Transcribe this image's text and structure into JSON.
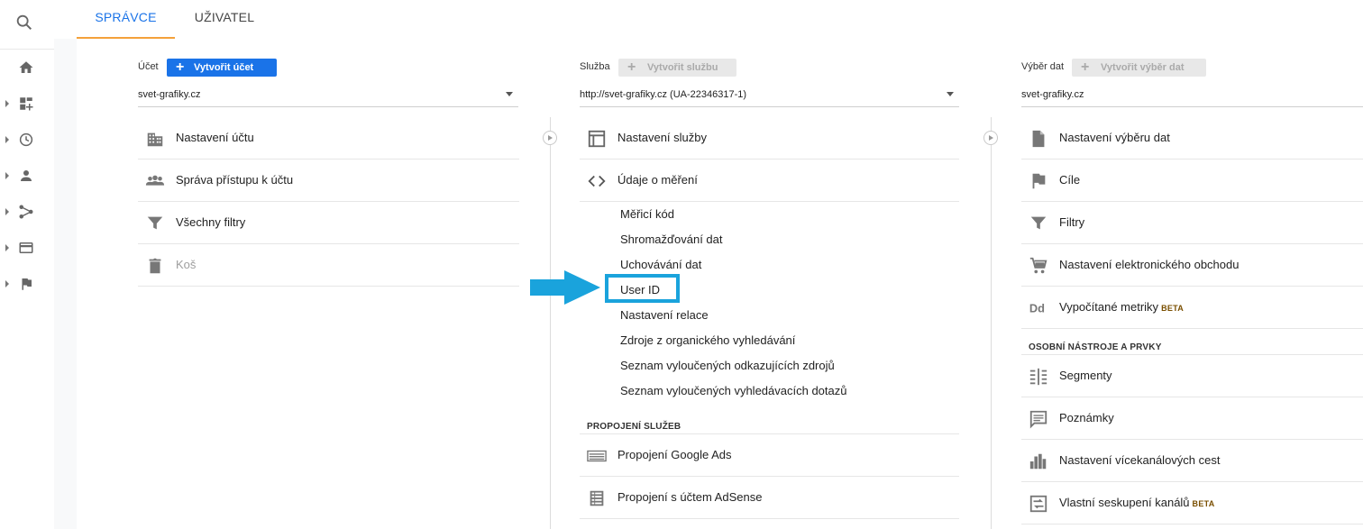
{
  "tabs": [
    {
      "label": "SPRÁVCE",
      "active": true
    },
    {
      "label": "UŽIVATEL",
      "active": false
    }
  ],
  "rail": {
    "items": [
      "search-icon",
      "home-icon",
      "dashboard-add-icon",
      "clock-icon",
      "person-icon",
      "flow-icon",
      "card-icon",
      "flag-icon"
    ]
  },
  "account": {
    "label": "Účet",
    "create_button": "Vytvořit účet",
    "selected": "svet-grafiky.cz",
    "items": [
      {
        "label": "Nastavení účtu",
        "icon": "building-icon"
      },
      {
        "label": "Správa přístupu k účtu",
        "icon": "people-icon"
      },
      {
        "label": "Všechny filtry",
        "icon": "filter-icon"
      },
      {
        "label": "Koš",
        "icon": "trash-icon",
        "disabled": true
      }
    ]
  },
  "property": {
    "label": "Služba",
    "create_button": "Vytvořit službu",
    "selected": "http://svet-grafiky.cz (UA-22346317-1)",
    "items": [
      {
        "label": "Nastavení služby",
        "icon": "layout-icon"
      },
      {
        "label": "Údaje o měření",
        "icon": "code-icon"
      }
    ],
    "subitems": [
      "Měřicí kód",
      "Shromažďování dat",
      "Uchovávání dat",
      "User ID",
      "Nastavení relace",
      "Zdroje z organického vyhledávání",
      "Seznam vyloučených odkazujících zdrojů",
      "Seznam vyloučených vyhledávacích dotazů"
    ],
    "section_heading": "PROPOJENÍ SLUŽEB",
    "links": [
      {
        "label": "Propojení Google Ads",
        "icon": "ads-icon"
      },
      {
        "label": "Propojení s účtem AdSense",
        "icon": "adsense-icon"
      }
    ]
  },
  "view": {
    "label": "Výběr dat",
    "create_button": "Vytvořit výběr dat",
    "selected": "svet-grafiky.cz",
    "items": [
      {
        "label": "Nastavení výběru dat",
        "icon": "document-icon"
      },
      {
        "label": "Cíle",
        "icon": "flag-icon"
      },
      {
        "label": "Filtry",
        "icon": "filter-icon"
      },
      {
        "label": "Nastavení elektronického obchodu",
        "icon": "cart-icon"
      },
      {
        "label": "Vypočítané metriky",
        "icon": "dd-icon",
        "badge": "BETA"
      }
    ],
    "section_heading": "OSOBNÍ NÁSTROJE A PRVKY",
    "tools": [
      {
        "label": "Segmenty",
        "icon": "segments-icon"
      },
      {
        "label": "Poznámky",
        "icon": "annotation-icon"
      },
      {
        "label": "Nastavení vícekanálových cest",
        "icon": "bars-icon"
      },
      {
        "label": "Vlastní seskupení kanálů",
        "icon": "channel-group-icon",
        "badge": "BETA"
      }
    ]
  },
  "annotation": {
    "highlight_color": "#1aa3dc",
    "highlighted_item": "User ID"
  },
  "colors": {
    "accent": "#1a73e8",
    "tab_underline": "#f4a13a",
    "icon": "#777777"
  }
}
